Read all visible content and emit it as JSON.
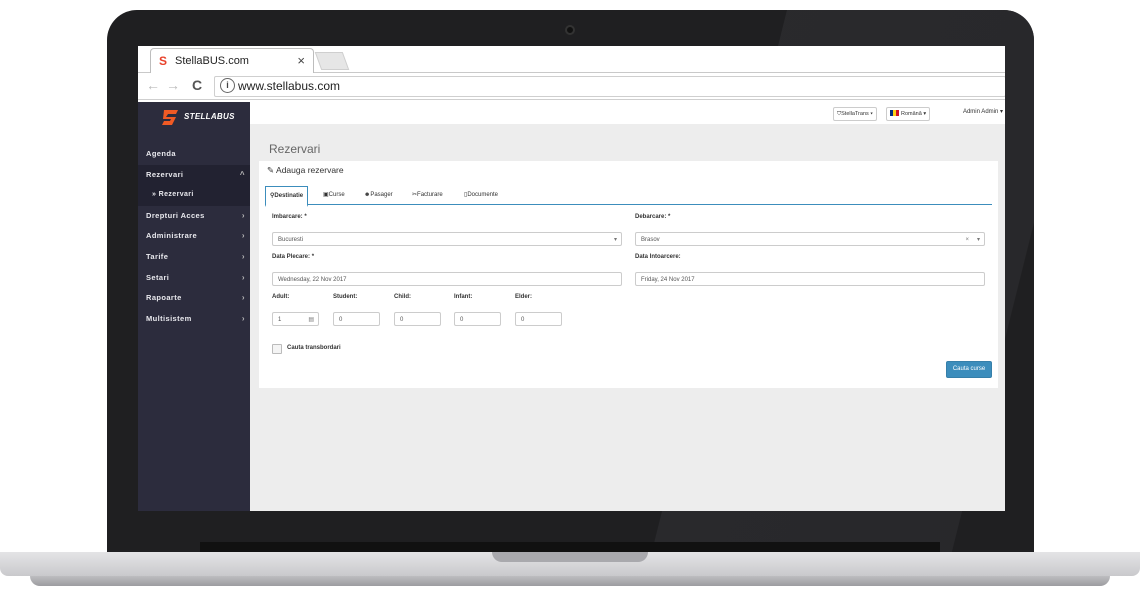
{
  "browser": {
    "tab_title": "StellaBUS.com",
    "tab_close": "×",
    "url": "www.stellabus.com",
    "info_glyph": "i"
  },
  "app": {
    "logo_text": "STELLABUS",
    "sidebar": {
      "items": [
        {
          "label": "Agenda"
        },
        {
          "label": "Rezervari",
          "chevron": "^"
        },
        {
          "label": "» Rezervari"
        },
        {
          "label": "Drepturi Acces",
          "chevron": "›"
        },
        {
          "label": "Administrare",
          "chevron": "›"
        },
        {
          "label": "Tarife",
          "chevron": "›"
        },
        {
          "label": "Setari",
          "chevron": "›"
        },
        {
          "label": "Rapoarte",
          "chevron": "›"
        },
        {
          "label": "Multisistem",
          "chevron": "›"
        }
      ]
    },
    "topbar": {
      "company_button": "StellaTrans ▾",
      "language_button": "Română ▾",
      "user_menu": "Admin Admin ▾"
    },
    "page_title": "Rezervari",
    "card_title": "Adauga rezervare",
    "tabs": [
      {
        "label": "Destinatie",
        "icon": "map-marker"
      },
      {
        "label": "Curse",
        "icon": "bus"
      },
      {
        "label": "Pasager",
        "icon": "users"
      },
      {
        "label": "Facturare",
        "icon": "tag"
      },
      {
        "label": "Documente",
        "icon": "file"
      }
    ],
    "form": {
      "imbarcare_label": "Imbarcare: *",
      "imbarcare_value": "Bucuresti",
      "debarcare_label": "Debarcare: *",
      "debarcare_value": "Brasov",
      "data_plecare_label": "Data Plecare: *",
      "data_plecare_value": "Wednesday, 22 Nov 2017",
      "data_intoarcere_label": "Data Intoarcere:",
      "data_intoarcere_value": "Friday, 24 Nov 2017",
      "passengers": [
        {
          "label": "Adult:",
          "value": "1"
        },
        {
          "label": "Student:",
          "value": "0"
        },
        {
          "label": "Child:",
          "value": "0"
        },
        {
          "label": "Infant:",
          "value": "0"
        },
        {
          "label": "Elder:",
          "value": "0"
        }
      ],
      "transfer_label": "Cauta transbordari",
      "search_button": "Cauta curse"
    },
    "colors": {
      "sidebar": "#2c2c3d",
      "accent": "#3c8dbc",
      "logo_orange": "#f05a24"
    }
  }
}
